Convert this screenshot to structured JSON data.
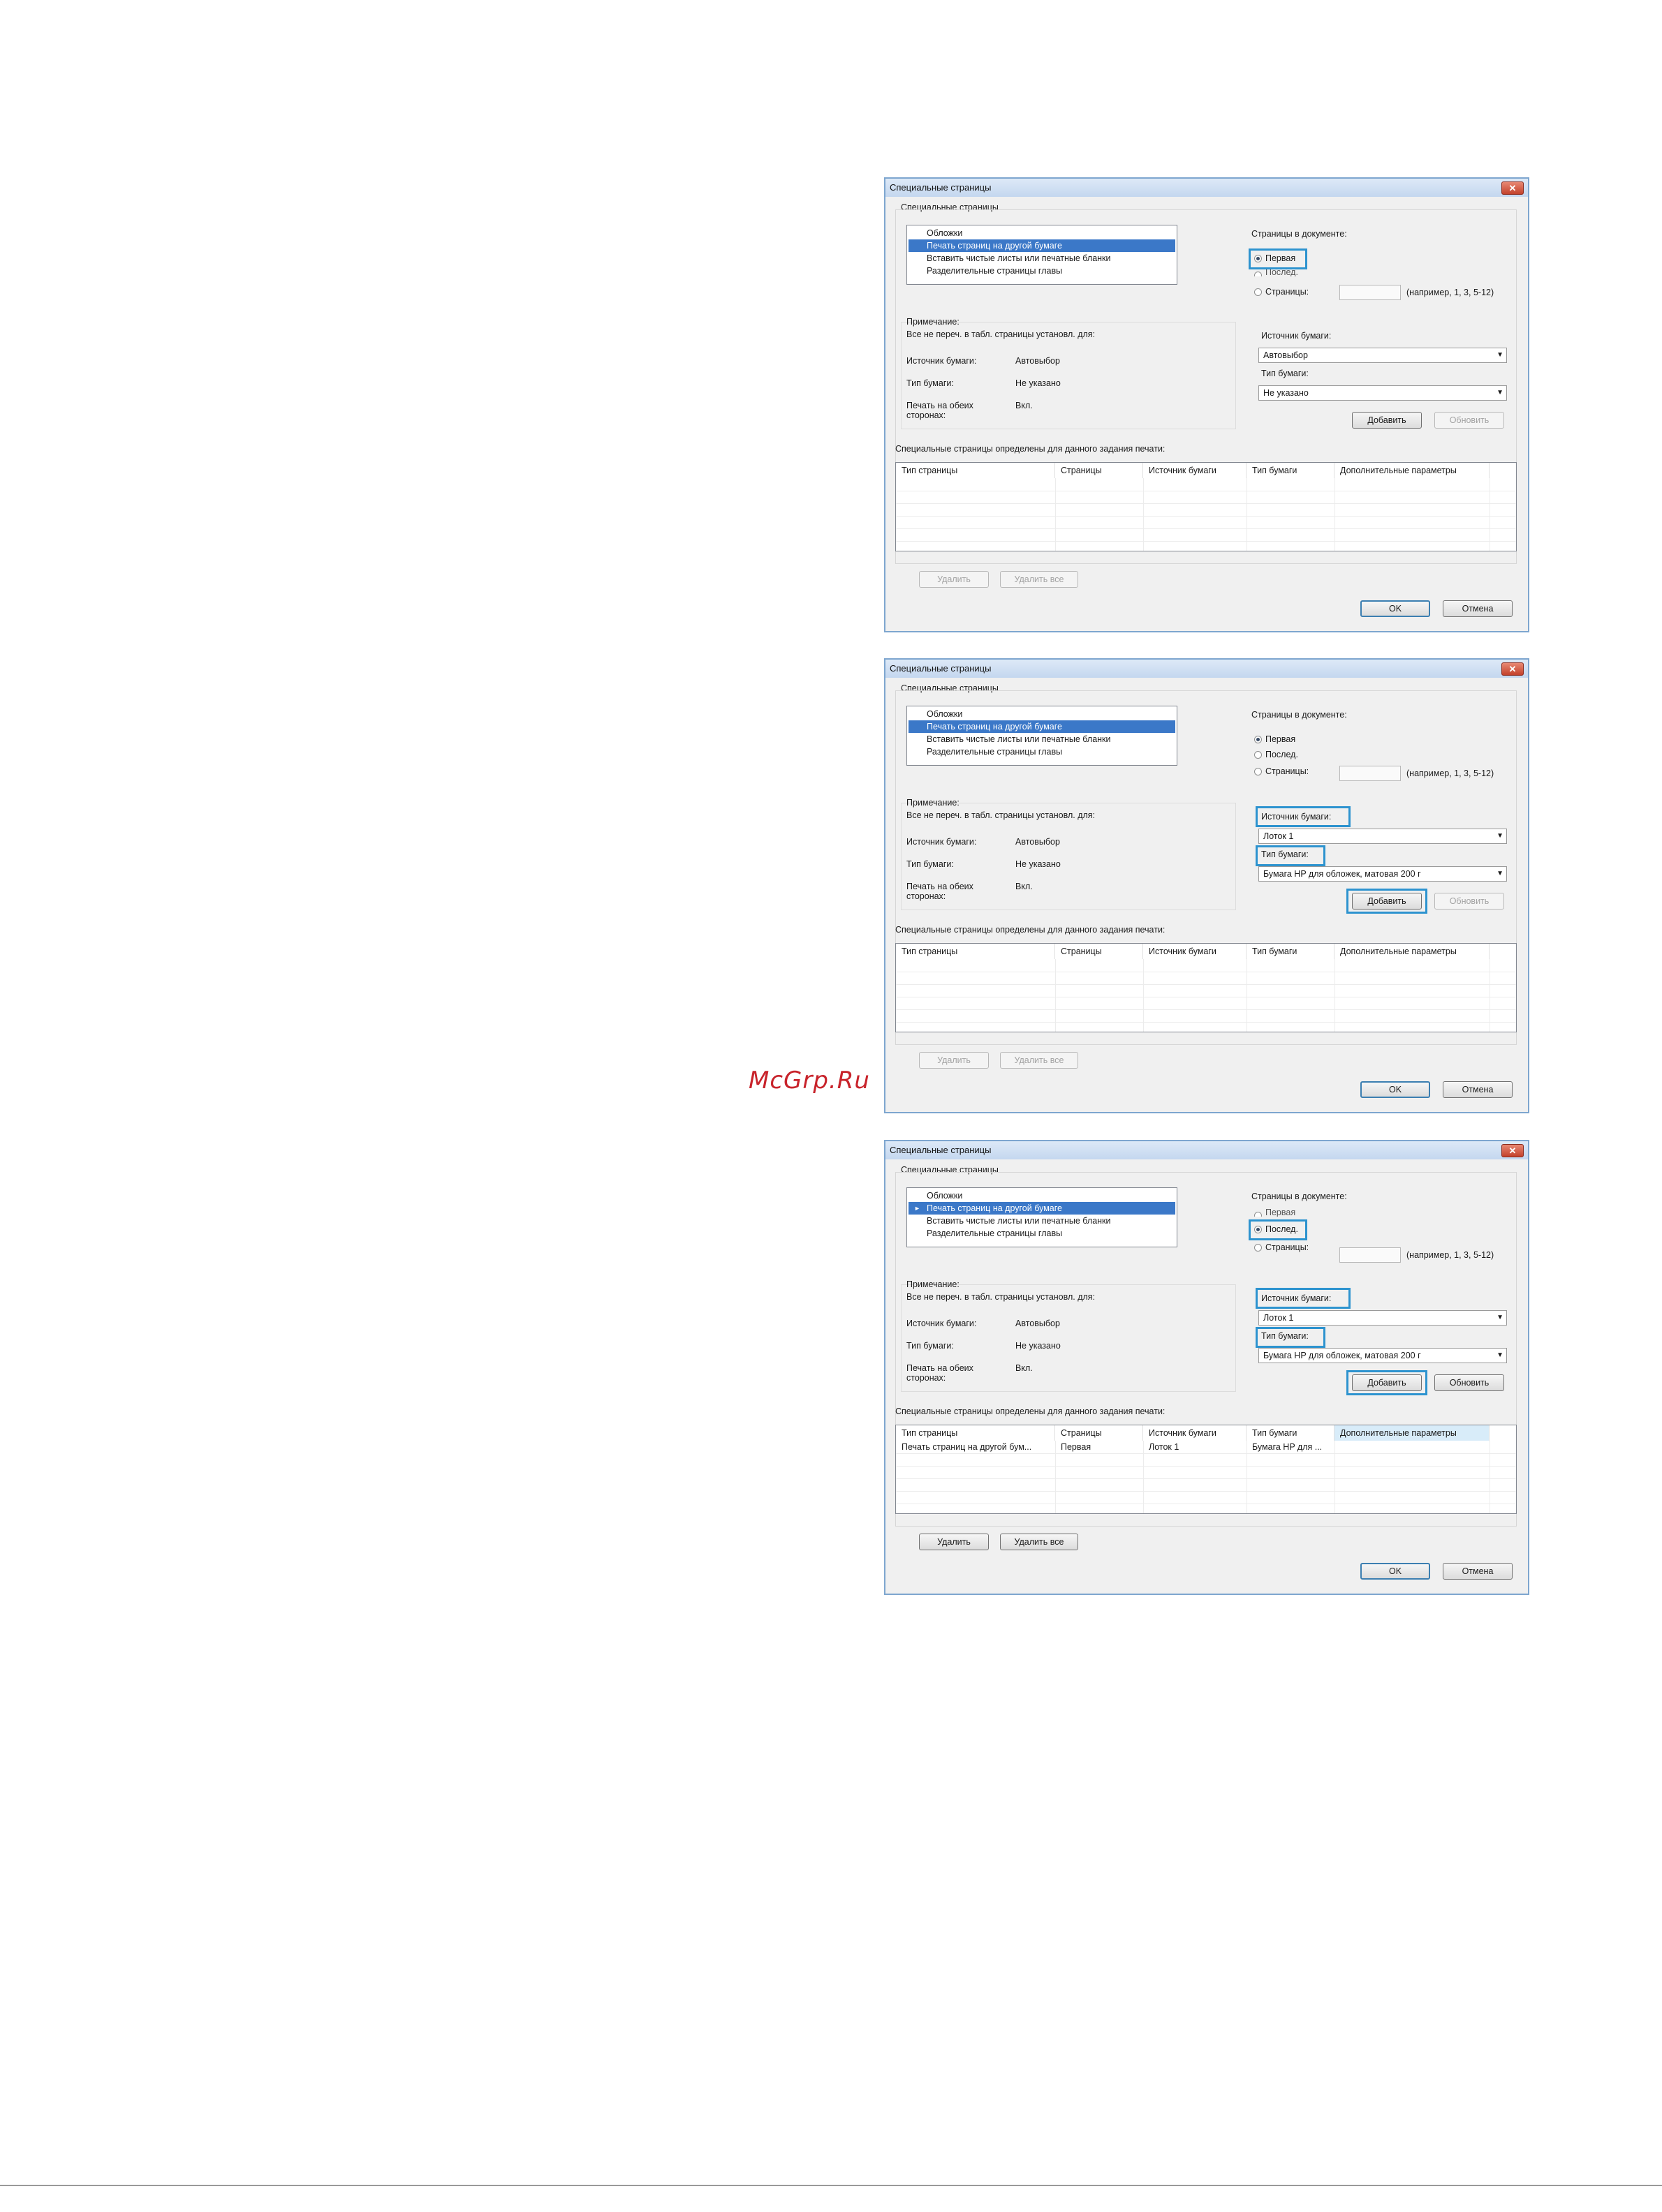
{
  "watermark": "McGrp.Ru",
  "shots": [
    {
      "window_title": "Специальные страницы",
      "group_label": "Специальные страницы",
      "list_items": [
        "Обложки",
        "Печать страниц на другой бумаге",
        "Вставить чистые листы или печатные бланки",
        "Разделительные страницы главы"
      ],
      "list_selected": 1,
      "doc_label": "Страницы в документе:",
      "radios": [
        {
          "label": "Первая",
          "checked": true
        },
        {
          "label": "Послед.",
          "checked": false
        },
        {
          "label": "Страницы:",
          "checked": false
        }
      ],
      "range_hint": "(например, 1, 3, 5-12)",
      "note_title": "Примечание:",
      "note_text": "Все не переч. в табл. страницы установл. для:",
      "settings": [
        {
          "key": "Источник бумаги:",
          "value": "Автовыбор"
        },
        {
          "key": "Тип бумаги:",
          "value": "Не указано"
        },
        {
          "key": "Печать на обеих сторонах:",
          "value": "Вкл."
        }
      ],
      "paper_source_label": "Источник бумаги:",
      "paper_source_value": "Автовыбор",
      "paper_type_label": "Тип бумаги:",
      "paper_type_value": "Не указано",
      "add_button": "Добавить",
      "update_button": "Обновить",
      "section_label": "Специальные страницы определены для данного задания печати:",
      "table_headers": [
        "Тип страницы",
        "Страницы",
        "Источник бумаги",
        "Тип бумаги",
        "Дополнительные параметры"
      ],
      "table_rows": [],
      "delete_button": "Удалить",
      "delete_all_button": "Удалить все",
      "ok_button": "OK",
      "cancel_button": "Отмена"
    },
    {
      "window_title": "Специальные страницы",
      "group_label": "Специальные страницы",
      "list_items": [
        "Обложки",
        "Печать страниц на другой бумаге",
        "Вставить чистые листы или печатные бланки",
        "Разделительные страницы главы"
      ],
      "list_selected": 1,
      "doc_label": "Страницы в документе:",
      "radios": [
        {
          "label": "Первая",
          "checked": true
        },
        {
          "label": "Послед.",
          "checked": false
        },
        {
          "label": "Страницы:",
          "checked": false
        }
      ],
      "range_hint": "(например, 1, 3, 5-12)",
      "note_title": "Примечание:",
      "note_text": "Все не переч. в табл. страницы установл. для:",
      "settings": [
        {
          "key": "Источник бумаги:",
          "value": "Автовыбор"
        },
        {
          "key": "Тип бумаги:",
          "value": "Не указано"
        },
        {
          "key": "Печать на обеих сторонах:",
          "value": "Вкл."
        }
      ],
      "paper_source_label": "Источник бумаги:",
      "paper_source_value": "Лоток 1",
      "paper_type_label": "Тип бумаги:",
      "paper_type_value": "Бумага HP для обложек, матовая 200 г",
      "add_button": "Добавить",
      "update_button": "Обновить",
      "section_label": "Специальные страницы определены для данного задания печати:",
      "table_headers": [
        "Тип страницы",
        "Страницы",
        "Источник бумаги",
        "Тип бумаги",
        "Дополнительные параметры"
      ],
      "table_rows": [],
      "delete_button": "Удалить",
      "delete_all_button": "Удалить все",
      "ok_button": "OK",
      "cancel_button": "Отмена"
    },
    {
      "window_title": "Специальные страницы",
      "group_label": "Специальные страницы",
      "list_items": [
        "Обложки",
        "Печать страниц на другой бумаге",
        "Вставить чистые листы или печатные бланки",
        "Разделительные страницы главы"
      ],
      "list_selected": 1,
      "doc_label": "Страницы в документе:",
      "radios": [
        {
          "label": "Первая",
          "checked": false
        },
        {
          "label": "Послед.",
          "checked": true
        },
        {
          "label": "Страницы:",
          "checked": false
        }
      ],
      "range_hint": "(например, 1, 3, 5-12)",
      "note_title": "Примечание:",
      "note_text": "Все не переч. в табл. страницы установл. для:",
      "settings": [
        {
          "key": "Источник бумаги:",
          "value": "Автовыбор"
        },
        {
          "key": "Тип бумаги:",
          "value": "Не указано"
        },
        {
          "key": "Печать на обеих сторонах:",
          "value": "Вкл."
        }
      ],
      "paper_source_label": "Источник бумаги:",
      "paper_source_value": "Лоток 1",
      "paper_type_label": "Тип бумаги:",
      "paper_type_value": "Бумага HP для обложек, матовая 200 г",
      "add_button": "Добавить",
      "update_button": "Обновить",
      "section_label": "Специальные страницы определены для данного задания печати:",
      "table_headers": [
        "Тип страницы",
        "Страницы",
        "Источник бумаги",
        "Тип бумаги",
        "Дополнительные параметры"
      ],
      "table_rows": [
        [
          "Печать страниц на другой бум...",
          "Первая",
          "Лоток 1",
          "Бумага HP для ..."
        ]
      ],
      "delete_button": "Удалить",
      "delete_all_button": "Удалить все",
      "ok_button": "OK",
      "cancel_button": "Отмена"
    }
  ]
}
